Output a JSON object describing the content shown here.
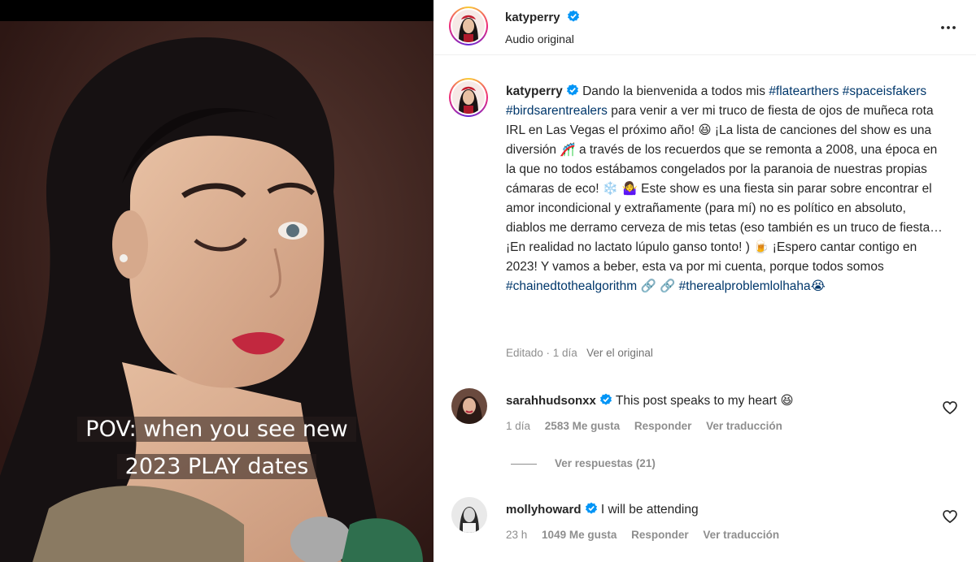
{
  "video": {
    "caption_line1": "POV: when you see new",
    "caption_line2": "2023 PLAY dates"
  },
  "header": {
    "username": "katyperry",
    "subtitle": "Audio original",
    "more_icon": "more-horizontal-icon"
  },
  "post": {
    "username": "katyperry",
    "parts": [
      " Dando la bienvenida a todos mis ",
      "#flatearthers",
      " ",
      "#spaceisfakers",
      " ",
      "#birdsarentrealers",
      " para venir a ver mi truco de fiesta de ojos de muñeca rota IRL en Las Vegas el próximo año! 😆 ¡La lista de canciones del show es una diversión 🎢 a través de los recuerdos que se remonta a 2008, una época en la que no todos estábamos congelados por la paranoia de nuestras propias cámaras de eco! ❄️ 🤷‍♀️ Este show es una fiesta sin parar sobre encontrar el amor incondicional y extrañamente (para mí) no es político en absoluto, diablos me derramo cerveza de mis tetas (eso también es un truco de fiesta… ¡En realidad no lactato lúpulo ganso tonto! ) 🍺 ¡Espero cantar contigo en 2023! Y vamos a beber, esta va por mi cuenta, porque todos somos ",
      "#chainedtothealgorithm",
      " ",
      "🔗 🔗",
      " ",
      "#therealproblemlolhaha😭"
    ],
    "edited": "Editado · 1 día",
    "see_original": "Ver el original"
  },
  "comments": [
    {
      "username": "sarahhudsonxx",
      "text": "This post speaks to my heart 😆",
      "time": "1 día",
      "likes": "2583 Me gusta",
      "reply": "Responder",
      "translate": "Ver traducción"
    },
    {
      "username": "mollyhoward",
      "text": "I will be attending",
      "time": "23 h",
      "likes": "1049 Me gusta",
      "reply": "Responder",
      "translate": "Ver traducción"
    }
  ],
  "replies_link": "Ver respuestas (21)",
  "colors": {
    "verified": "#0095f6",
    "hashtag": "#00376b",
    "muted": "#8e8e8e",
    "text": "#262626"
  }
}
